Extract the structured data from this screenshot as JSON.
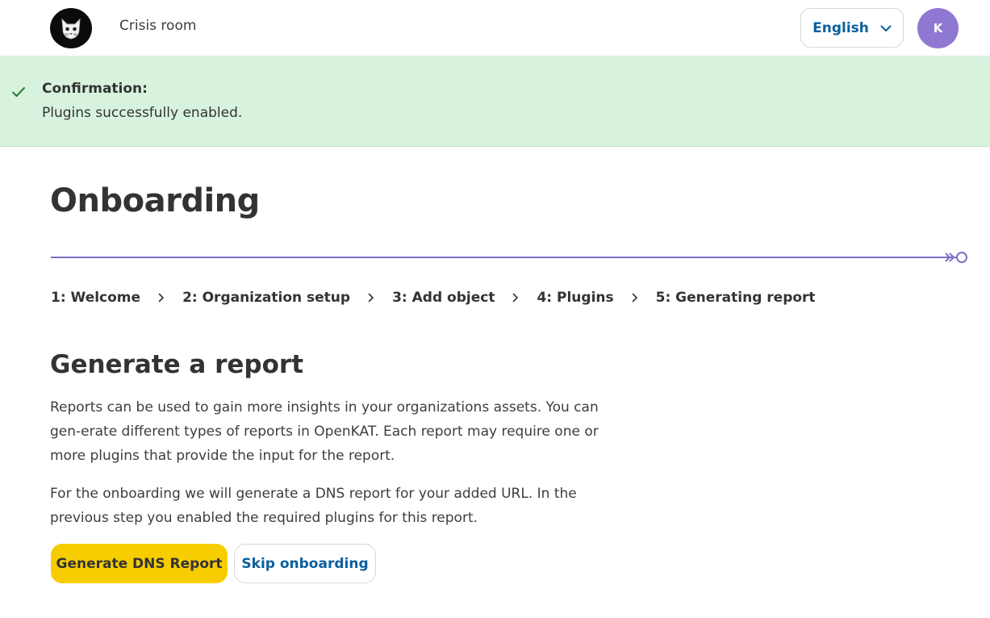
{
  "header": {
    "logo_icon": "cat-logo-icon",
    "nav_link": "Crisis room",
    "language": "English",
    "avatar_initial": "K"
  },
  "banner": {
    "title": "Confirmation:",
    "message": "Plugins successfully enabled.",
    "bg_color": "#d7f3de",
    "icon": "checkmark-icon"
  },
  "main": {
    "title": "Onboarding",
    "steps": [
      {
        "label": "1: Welcome"
      },
      {
        "label": "2: Organization setup"
      },
      {
        "label": "3: Add object"
      },
      {
        "label": "4: Plugins"
      },
      {
        "label": "5: Generating report"
      }
    ],
    "progress_color": "#7f6ec6",
    "section_title": "Generate a report",
    "paragraph1": "Reports can be used to gain more insights in your organizations assets. You can gen-erate different types of reports in OpenKAT. Each report may require one or more plugins that provide the input for the report.",
    "paragraph2": "For the onboarding we will generate a DNS report for your added URL. In the previous step you enabled the required plugins for this report.",
    "primary_button": "Generate DNS Report",
    "secondary_button": "Skip onboarding",
    "accent_color": "#f7cd00",
    "link_color": "#0a5f9e"
  }
}
